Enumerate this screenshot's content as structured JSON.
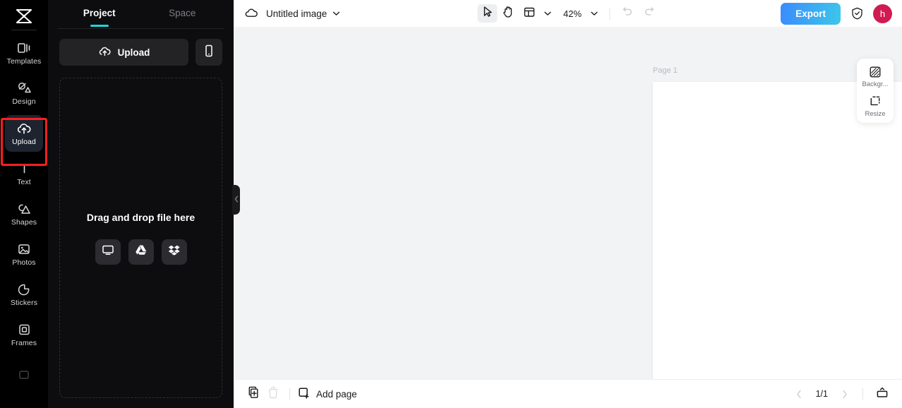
{
  "app": {
    "name": "CapCut",
    "logo_icon": "capcut-logo-icon"
  },
  "rail": {
    "items": [
      {
        "label": "Templates",
        "icon": "templates-icon",
        "active": false
      },
      {
        "label": "Design",
        "icon": "design-icon",
        "active": false
      },
      {
        "label": "Upload",
        "icon": "upload-cloud-icon",
        "active": true
      },
      {
        "label": "Text",
        "icon": "text-icon",
        "active": false
      },
      {
        "label": "Shapes",
        "icon": "shapes-icon",
        "active": false
      },
      {
        "label": "Photos",
        "icon": "photos-icon",
        "active": false
      },
      {
        "label": "Stickers",
        "icon": "stickers-icon",
        "active": false
      },
      {
        "label": "Frames",
        "icon": "frames-icon",
        "active": false
      }
    ],
    "highlight_color": "#ff1f1f",
    "active_bg": "#1d242f"
  },
  "panel": {
    "tabs": [
      {
        "label": "Project",
        "active": true
      },
      {
        "label": "Space",
        "active": false
      }
    ],
    "tab_accent": "#20d5d5",
    "upload_button": {
      "label": "Upload",
      "icon": "upload-cloud-icon"
    },
    "phone_button": {
      "icon": "mobile-phone-icon"
    },
    "dropzone": {
      "text": "Drag and drop file here",
      "sources": [
        {
          "name": "computer",
          "icon": "monitor-icon"
        },
        {
          "name": "google-drive",
          "icon": "google-drive-icon"
        },
        {
          "name": "dropbox",
          "icon": "dropbox-icon"
        }
      ]
    },
    "collapse_icon": "chevron-left-icon"
  },
  "topbar": {
    "cloud_icon": "cloud-save-icon",
    "doc_title": "Untitled image",
    "title_caret": "chevron-down-icon",
    "tools": [
      {
        "name": "select",
        "icon": "cursor-arrow-icon",
        "active": true
      },
      {
        "name": "hand",
        "icon": "hand-icon",
        "active": false
      },
      {
        "name": "layout",
        "icon": "layout-panel-icon",
        "active": false
      }
    ],
    "zoom": "42%",
    "zoom_caret": "chevron-down-icon",
    "undo": {
      "icon": "undo-icon",
      "enabled": false
    },
    "redo": {
      "icon": "redo-icon",
      "enabled": false
    },
    "export_label": "Export",
    "export_gradient": [
      "#3a8bfd",
      "#3dc7ea"
    ],
    "shield_icon": "shield-check-icon",
    "avatar": {
      "initial": "h",
      "color": "#d01b52"
    }
  },
  "stage": {
    "page_label": "Page 1",
    "canvas_color": "#ffffff",
    "background_color": "#f2f3f5"
  },
  "right_float": [
    {
      "label": "Backgr...",
      "icon": "background-hatch-icon"
    },
    {
      "label": "Resize",
      "icon": "resize-icon"
    }
  ],
  "bottombar": {
    "duplicate": {
      "icon": "duplicate-page-icon",
      "enabled": true
    },
    "delete": {
      "icon": "trash-icon",
      "enabled": false
    },
    "add_page": {
      "label": "Add page",
      "icon": "add-page-icon"
    },
    "prev": {
      "icon": "chevron-left-icon",
      "enabled": false
    },
    "page_count": "1/1",
    "next": {
      "icon": "chevron-right-icon",
      "enabled": false
    },
    "panel_toggle": {
      "icon": "page-panel-icon"
    }
  }
}
